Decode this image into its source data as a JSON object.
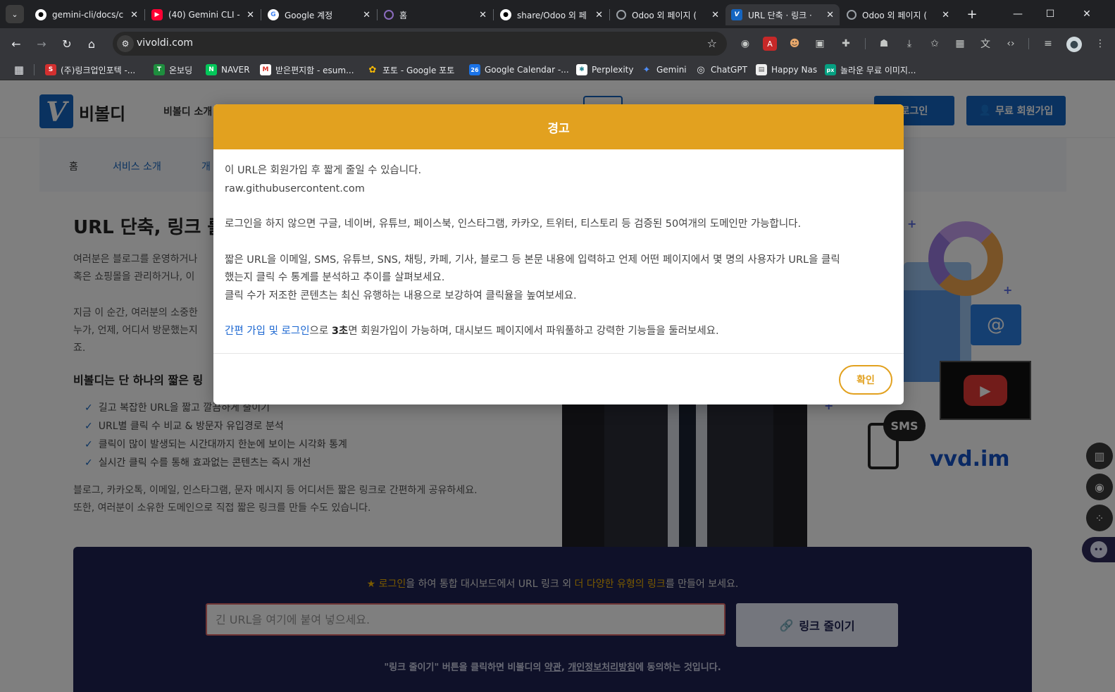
{
  "browser": {
    "tabs": [
      {
        "title": "gemini-cli/docs/c",
        "icon": "github-icon",
        "color": "#ffffff"
      },
      {
        "title": "(40) Gemini CLI -",
        "icon": "youtube-icon",
        "color": "#ff0033"
      },
      {
        "title": "Google 계정",
        "icon": "google-icon",
        "color": "#4285f4"
      },
      {
        "title": "홈",
        "icon": "circle-icon",
        "color": "#8a6bbd"
      },
      {
        "title": "share/Odoo 외 페",
        "icon": "github-icon",
        "color": "#ffffff"
      },
      {
        "title": "Odoo 외 페이지 (",
        "icon": "globe-icon",
        "color": "#9aa0a6"
      },
      {
        "title": "URL 단축 · 링크 ·",
        "icon": "vivoldi-icon",
        "color": "#1565c0"
      },
      {
        "title": "Odoo 외 페이지 (",
        "icon": "globe-icon",
        "color": "#9aa0a6"
      }
    ],
    "address": "vivoldi.com",
    "bookmarks": [
      {
        "label": "(주)링크업인포텍 -...",
        "color": "#d32f2f",
        "glyph": "S"
      },
      {
        "label": "온보딩",
        "color": "#1e8e3e",
        "glyph": "T"
      },
      {
        "label": "NAVER",
        "color": "#03c75a",
        "glyph": "N"
      },
      {
        "label": "받은편지함 - esum...",
        "color": "#d93025",
        "glyph": "M"
      },
      {
        "label": "포토 - Google 포토",
        "color": "#fbbc04",
        "glyph": "✿"
      },
      {
        "label": "Google Calendar -...",
        "color": "#1a73e8",
        "glyph": "26"
      },
      {
        "label": "Perplexity",
        "color": "#20808d",
        "glyph": "✱"
      },
      {
        "label": "Gemini",
        "color": "#4f8ef7",
        "glyph": "✦"
      },
      {
        "label": "ChatGPT",
        "color": "#10a37f",
        "glyph": "◎"
      },
      {
        "label": "Happy Nas",
        "color": "#eeeeee",
        "glyph": "▤"
      },
      {
        "label": "놀라운 무료 이미지...",
        "color": "#05a081",
        "glyph": "px"
      }
    ]
  },
  "site": {
    "logo_letter": "V",
    "logo_text": "비볼디",
    "nav_item": "비볼디 소개",
    "login": "로그인",
    "signup": "무료 회원가입",
    "subnav": [
      "홈",
      "서비스 소개",
      "개"
    ],
    "hero_title": "URL 단축, 링크 를",
    "intro_lines": [
      "여러분은 블로그를 운영하거나",
      "혹은 쇼핑몰을 관리하거나, 이"
    ],
    "moment_lines": [
      "지금 이 순간, 여러분의 소중한",
      "누가, 언제, 어디서 방문했는지",
      "죠."
    ],
    "sub_heading": "비볼디는 단 하나의 짧은 링",
    "features": [
      "길고 복잡한 URL을 짧고 깔끔하게 줄이기",
      "URL별 클릭 수 비교 & 방문자 유입경로 분석",
      "클릭이 많이 발생되는 시간대까지 한눈에 보이는 시각화 통계",
      "실시간 클릭 수를 통해 효과없는 콘텐츠는 즉시 개선"
    ],
    "share_lines": [
      "블로그, 카카오톡, 이메일, 인스타그램, 문자 메시지 등 어디서든 짧은 링크로 간편하게 공유하세요.",
      "또한, 여러분이 소유한 도메인으로 직접 짧은 링크를 만들 수도 있습니다."
    ],
    "illus_sms": "SMS",
    "illus_domain": "vvd.im",
    "promo": {
      "login_word": "로그인",
      "middle": "을 하여 통합 대시보드에서 URL 링크 외",
      "highlight": "더 다양한 유형의 링크",
      "end": "를 만들어 보세요."
    },
    "url_placeholder": "긴 URL을 여기에 붙여 넣으세요.",
    "shorten_label": "링크 줄이기",
    "terms": {
      "pre": "\"링크 줄이기\" 버튼을 클릭하면 비볼디의",
      "link1": "약관",
      "comma": ",",
      "link2": "개인정보처리방침",
      "post": "에 동의하는 것입니다."
    }
  },
  "modal": {
    "title": "경고",
    "line1": "이 URL은 회원가입 후 짧게 줄일 수 있습니다.",
    "line2": "raw.githubusercontent.com",
    "line3": "로그인을 하지 않으면 구글, 네이버, 유튜브, 페이스북, 인스타그램, 카카오, 트위터, 티스토리 등 검증된 50여개의 도메인만 가능합니다.",
    "line4a": "짧은 URL을 이메일, SMS, 유튜브, SNS, 채팅, 카페, 기사, 블로그 등 본문 내용에 입력하고 언제 어떤 페이지에서 몇 명의 사용자가 URL을 클릭",
    "line4b": "했는지 클릭 수 통계를 분석하고 추이를 살펴보세요.",
    "line5": "클릭 수가 저조한 콘텐츠는 최신 유행하는 내용으로 보강하여 클릭율을 높여보세요.",
    "link_text": "간편 가입 및 로그인",
    "after_link": "으로",
    "bold": "3초",
    "rest": "면 회원가입이 가능하며, 대시보드 페이지에서 파워풀하고 강력한 기능들을 둘러보세요.",
    "confirm": "확인"
  }
}
